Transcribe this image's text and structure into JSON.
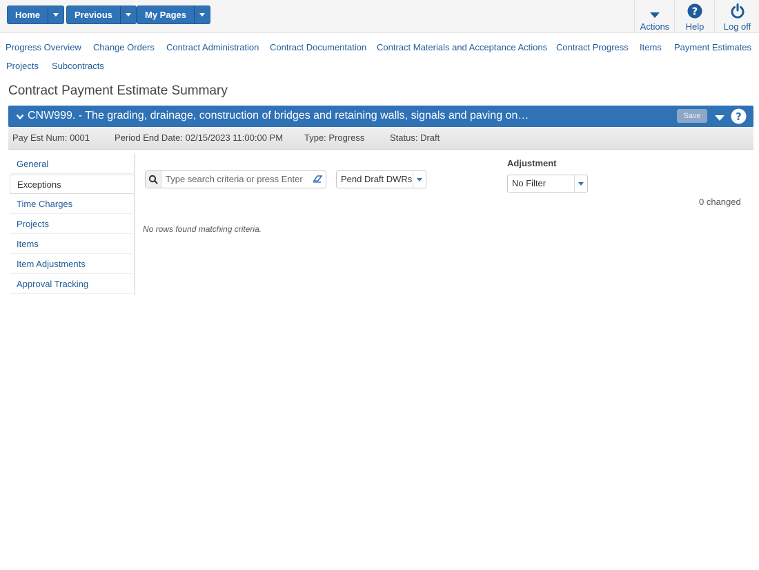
{
  "topnav": {
    "home": "Home",
    "previous": "Previous",
    "my_pages": "My Pages",
    "actions": "Actions",
    "help": "Help",
    "logoff": "Log off"
  },
  "links": [
    "Progress Overview",
    "Change Orders",
    "Contract Administration",
    "Contract Documentation",
    "Contract Materials and Acceptance Actions",
    "Contract Progress",
    "Items",
    "Payment Estimates",
    "Projects",
    "Subcontracts"
  ],
  "page": {
    "title": "Contract Payment Estimate Summary",
    "header": "CNW999. - The grading, drainage, construction of bridges and retaining walls, signals and paving on…",
    "save": "Save"
  },
  "info": {
    "pay_est": "Pay Est Num: 0001",
    "period_end": "Period End Date: 02/15/2023 11:00:00 PM",
    "type": "Type: Progress",
    "status": "Status: Draft"
  },
  "sidebar": {
    "items": [
      "General",
      "Exceptions",
      "Time Charges",
      "Projects",
      "Items",
      "Item Adjustments",
      "Approval Tracking"
    ]
  },
  "filters": {
    "search_placeholder": "Type search criteria or press Enter",
    "pend_draft": "Pend Draft DWRs",
    "adjustment_label": "Adjustment",
    "adjustment_value": "No Filter",
    "changed": "0 changed",
    "no_rows": "No rows found matching criteria."
  },
  "colors": {
    "primary": "#2f72b6",
    "link": "#1f5c99"
  }
}
